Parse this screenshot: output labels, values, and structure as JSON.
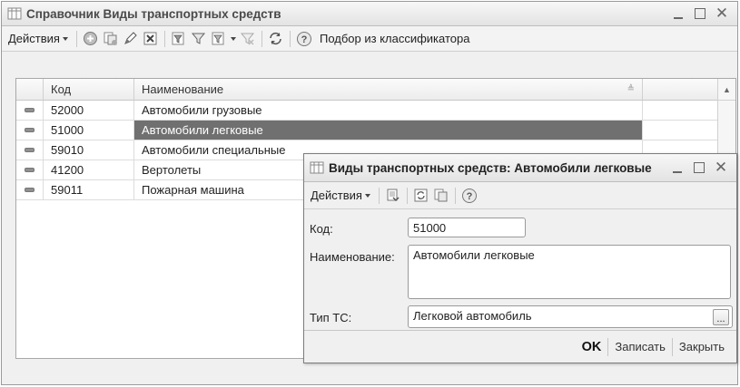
{
  "main_window": {
    "title": "Справочник Виды транспортных средств",
    "toolbar": {
      "actions_label": "Действия",
      "classifier_label": "Подбор из классификатора",
      "icons": [
        "add-icon",
        "copy-icon",
        "edit-icon",
        "delete-icon",
        "filter-icon",
        "filter-set-icon",
        "filter-dropdown-icon",
        "filter-clear-icon",
        "refresh-icon",
        "help-icon"
      ]
    },
    "table": {
      "columns": [
        "Код",
        "Наименование"
      ],
      "rows": [
        {
          "code": "52000",
          "name": "Автомобили грузовые",
          "selected": false
        },
        {
          "code": "51000",
          "name": "Автомобили легковые",
          "selected": true
        },
        {
          "code": "59010",
          "name": "Автомобили специальные",
          "selected": false
        },
        {
          "code": "41200",
          "name": "Вертолеты",
          "selected": false
        },
        {
          "code": "59011",
          "name": "Пожарная машина",
          "selected": false
        }
      ]
    }
  },
  "dialog": {
    "title": "Виды транспортных средств: Автомобили легковые",
    "toolbar": {
      "actions_label": "Действия",
      "icons": [
        "save-write-icon",
        "reread-icon",
        "copy-icon",
        "help-icon"
      ]
    },
    "fields": {
      "code_label": "Код:",
      "code_value": "51000",
      "name_label": "Наименование:",
      "name_value": "Автомобили легковые",
      "type_label": "Тип ТС:",
      "type_value": "Легковой автомобиль",
      "select_button": "..."
    },
    "buttons": {
      "ok": "OK",
      "save": "Записать",
      "close": "Закрыть"
    }
  },
  "colors": {
    "selected_row": "#707070",
    "window_bg": "#f0f0f0"
  }
}
